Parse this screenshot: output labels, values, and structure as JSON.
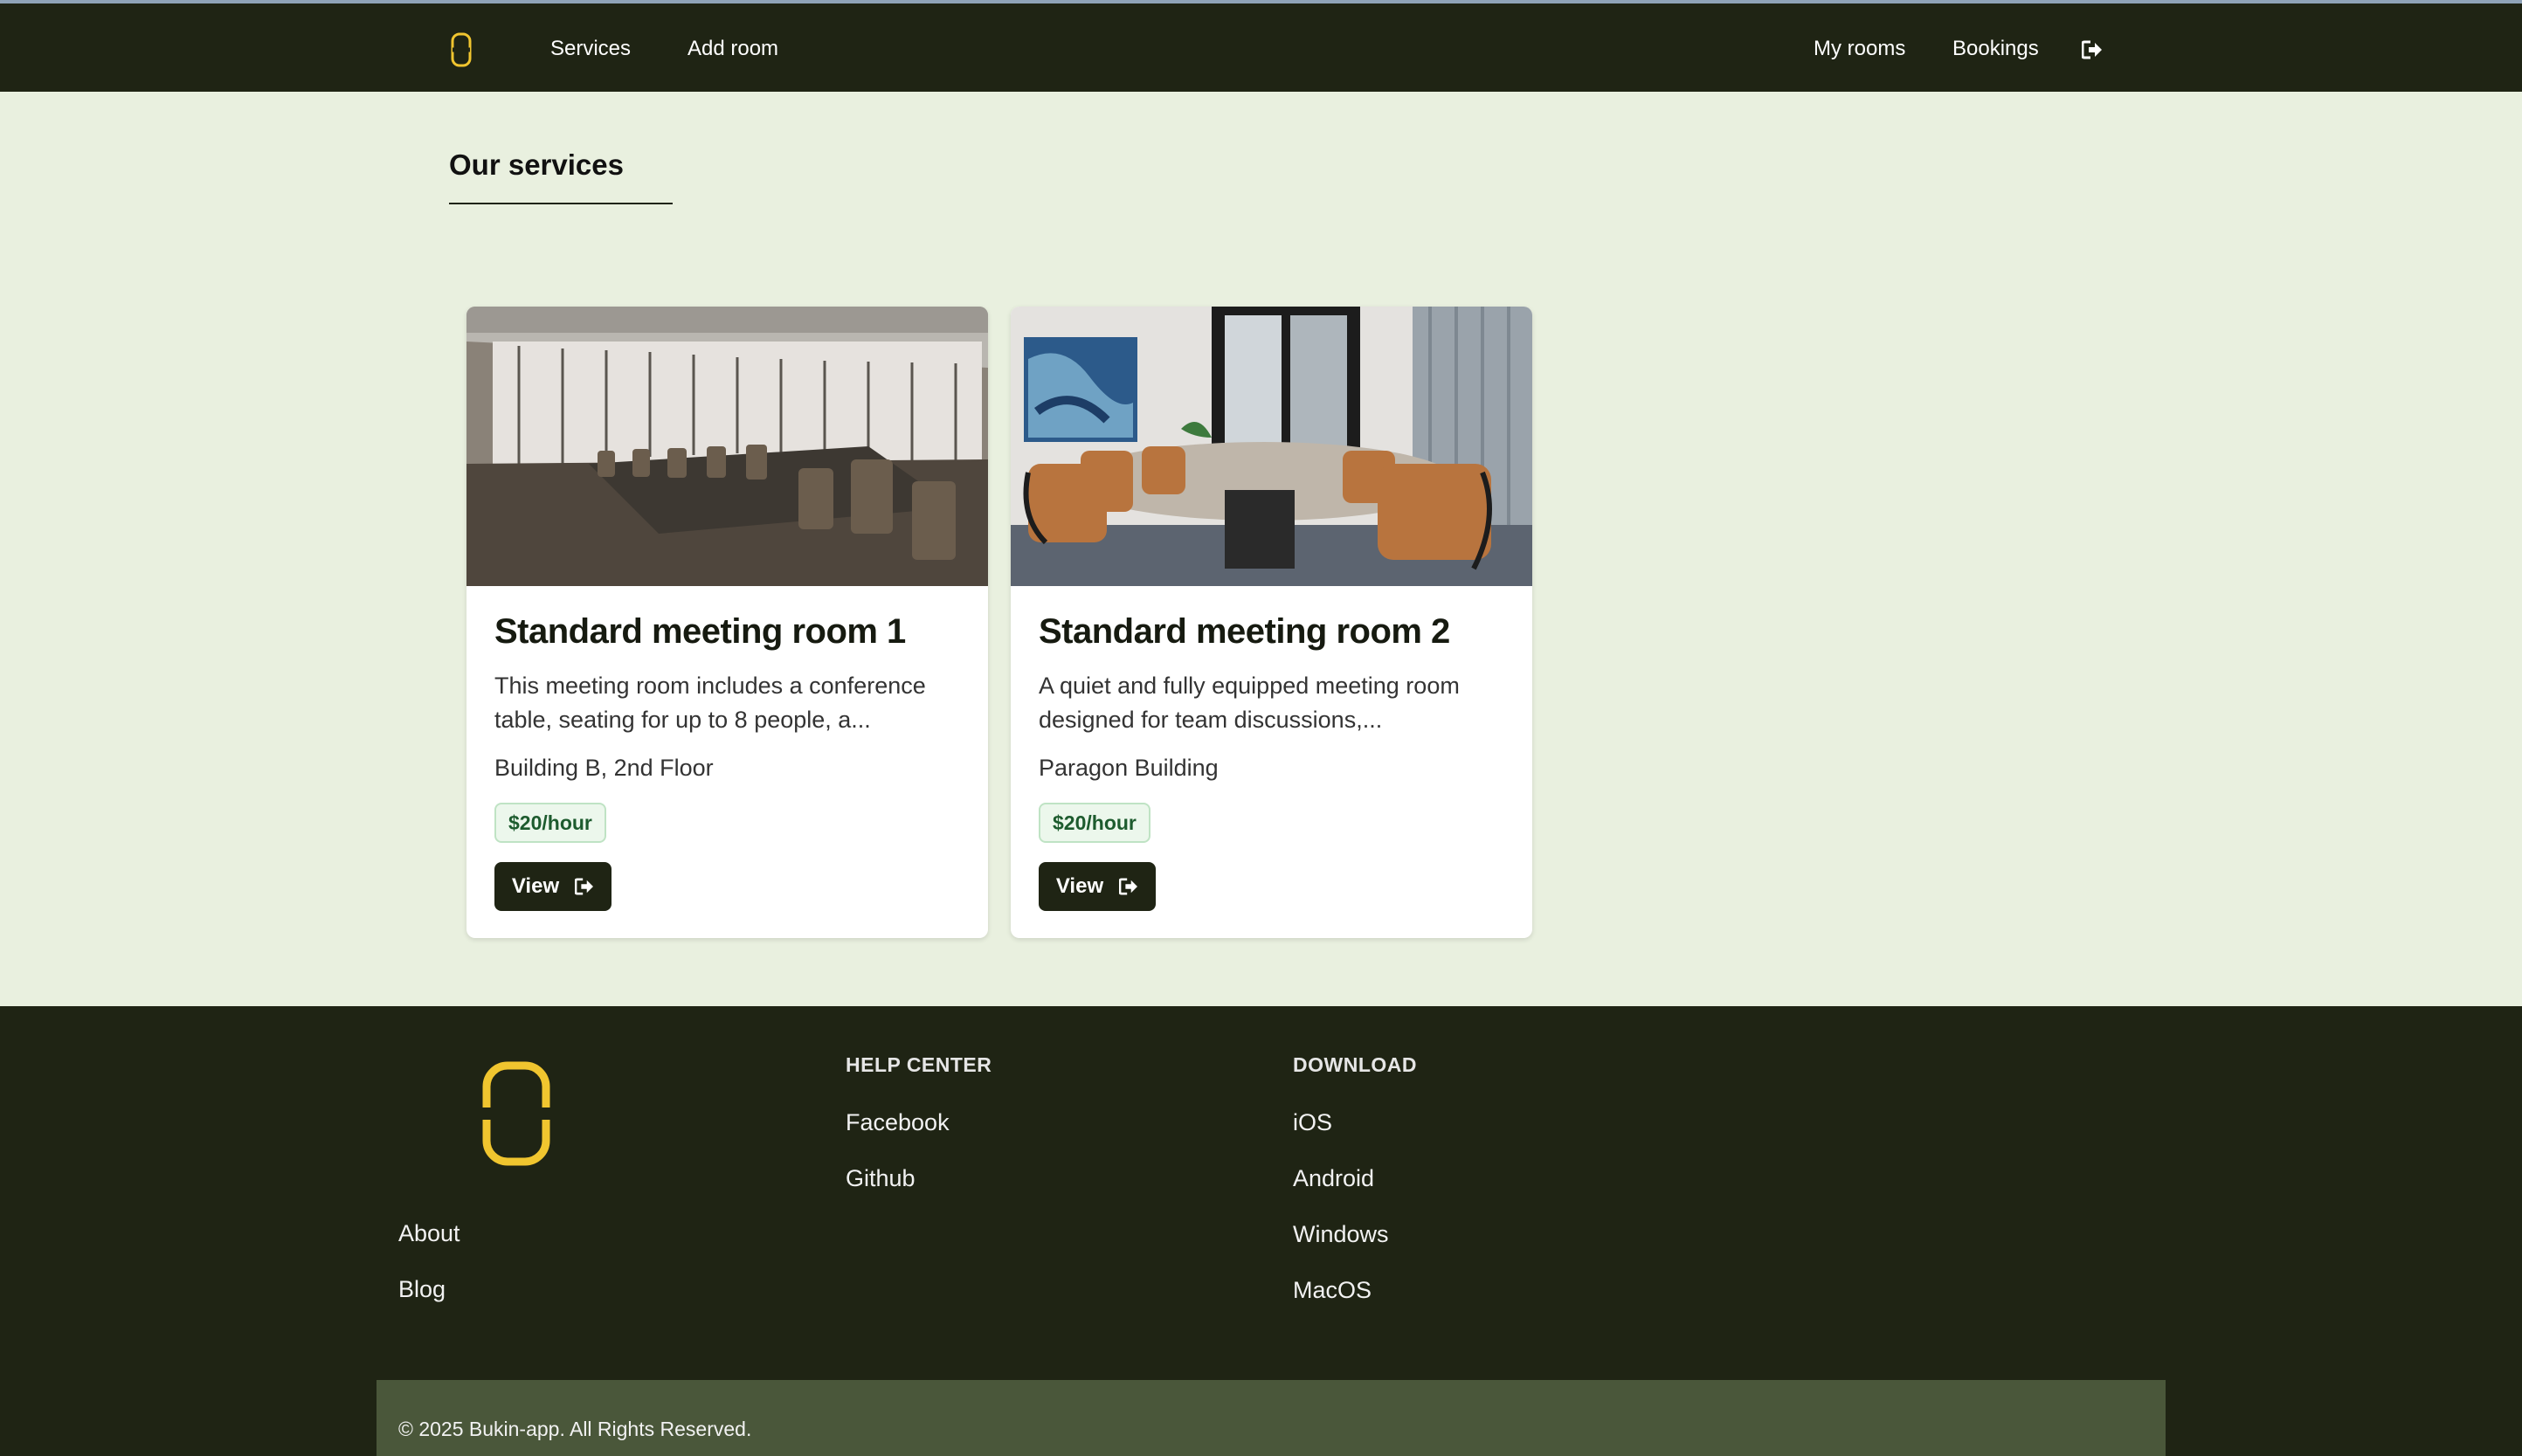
{
  "nav": {
    "logo": "bukin-logo",
    "links": [
      "Services",
      "Add room"
    ],
    "right_links": [
      "My rooms",
      "Bookings"
    ],
    "exit_icon": "sign-out-icon"
  },
  "main": {
    "title": "Our services",
    "cards": [
      {
        "title": "Standard meeting room 1",
        "description": "This meeting room includes a conference table, seating for up to 8 people, a...",
        "location": "Building B, 2nd Floor",
        "price": "$20/hour",
        "button": "View"
      },
      {
        "title": "Standard meeting room 2",
        "description": "A quiet and fully equipped meeting room designed for team discussions,...",
        "location": "Paragon Building",
        "price": "$20/hour",
        "button": "View"
      }
    ]
  },
  "footer": {
    "logo": "bukin-logo",
    "links": [
      "About",
      "Blog"
    ],
    "help_center": {
      "heading": "HELP CENTER",
      "links": [
        "Facebook",
        "Github"
      ]
    },
    "download": {
      "heading": "DOWNLOAD",
      "links": [
        "iOS",
        "Android",
        "Windows",
        "MacOS"
      ]
    },
    "copyright": "© 2025 Bukin-app. All Rights Reserved."
  },
  "colors": {
    "nav_bg": "#1f2414",
    "page_bg": "#e9f0df",
    "accent": "#f0c52f",
    "price_text": "#1d5b2e",
    "footer_bottom": "#4a573a"
  }
}
